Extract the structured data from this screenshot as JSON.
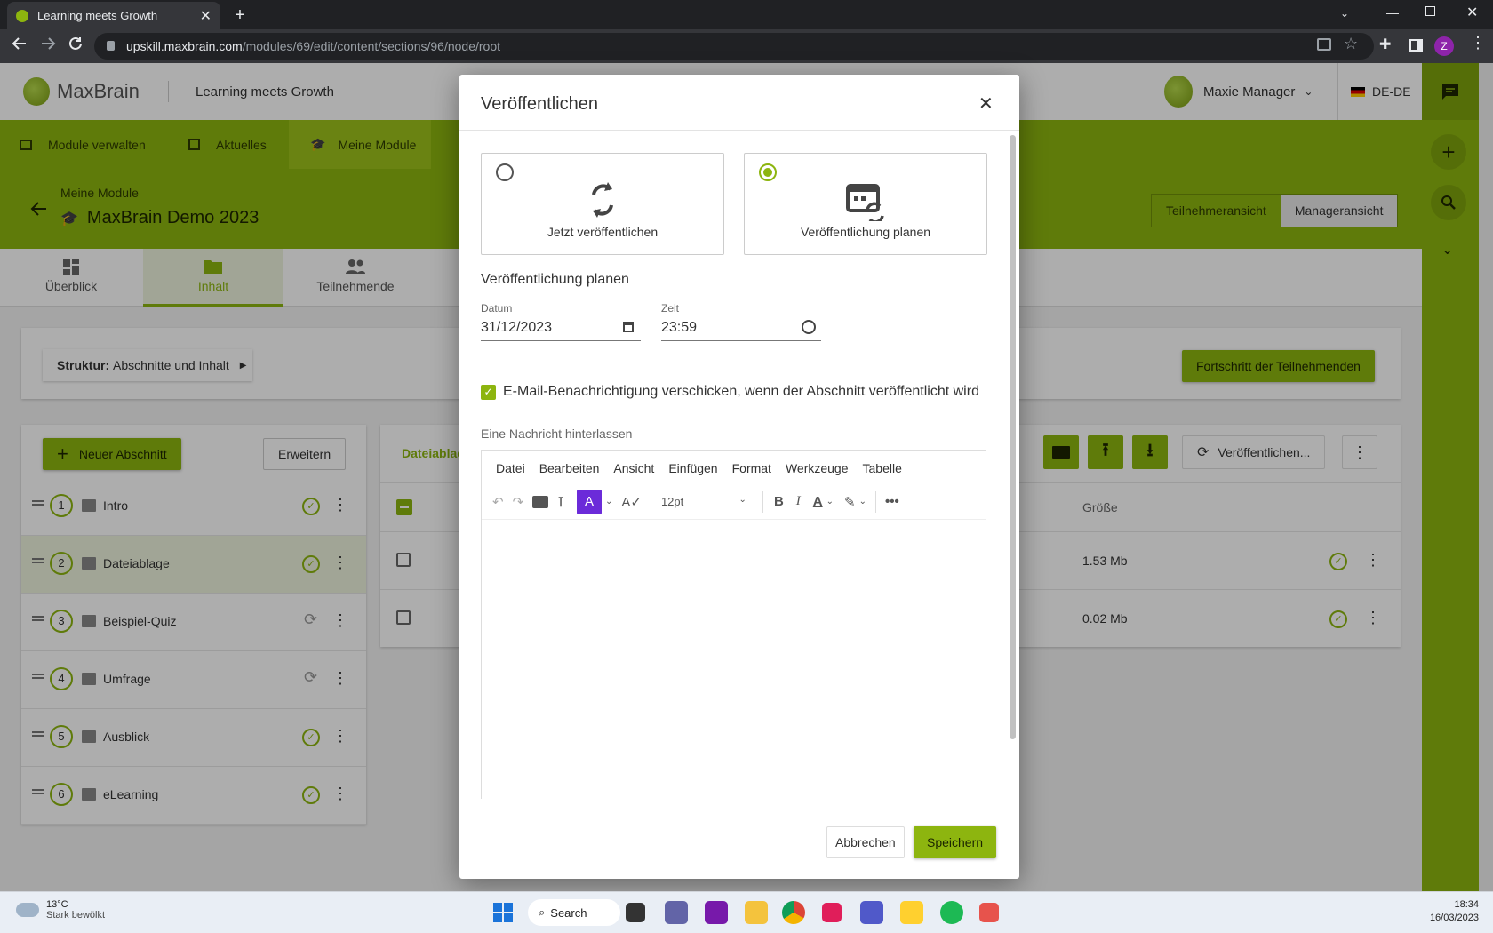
{
  "browser": {
    "tab_title": "Learning meets Growth",
    "url_host": "upskill.maxbrain.com",
    "url_path": "/modules/69/edit/content/sections/96/node/root",
    "profile_initial": "Z"
  },
  "header": {
    "brand": "MaxBrain",
    "tagline": "Learning meets Growth",
    "user_name": "Maxie Manager",
    "language": "DE-DE"
  },
  "topnav": {
    "items": [
      {
        "label": "Module verwalten"
      },
      {
        "label": "Aktuelles"
      },
      {
        "label": "Meine Module"
      }
    ]
  },
  "title": {
    "breadcrumb": "Meine Module",
    "module_name": "MaxBrain Demo 2023",
    "view_participant": "Teilnehmeransicht",
    "view_manager": "Manageransicht"
  },
  "page_tabs": [
    {
      "label": "Überblick"
    },
    {
      "label": "Inhalt"
    },
    {
      "label": "Teilnehmende"
    }
  ],
  "toolbar": {
    "structure_prefix": "Struktur:",
    "structure_value": "Abschnitte und Inhalt",
    "progress_button": "Fortschritt der Teilnehmenden",
    "new_section": "Neuer Abschnitt",
    "expand": "Erweitern",
    "publish_button": "Veröffentlichen...",
    "panel_title": "Dateiablag"
  },
  "sections": [
    {
      "num": "1",
      "label": "Intro",
      "status": "published"
    },
    {
      "num": "2",
      "label": "Dateiablage",
      "status": "published"
    },
    {
      "num": "3",
      "label": "Beispiel-Quiz",
      "status": "pending"
    },
    {
      "num": "4",
      "label": "Umfrage",
      "status": "pending"
    },
    {
      "num": "5",
      "label": "Ausblick",
      "status": "published"
    },
    {
      "num": "6",
      "label": "eLearning",
      "status": "published"
    }
  ],
  "files": {
    "size_header": "Größe",
    "rows": [
      {
        "size": "1.53 Mb"
      },
      {
        "size": "0.02 Mb"
      }
    ]
  },
  "modal": {
    "title": "Veröffentlichen",
    "option_now": "Jetzt veröffentlichen",
    "option_schedule": "Veröffentlichung planen",
    "selected_option": "schedule",
    "schedule_heading": "Veröffentlichung planen",
    "date_label": "Datum",
    "date_value": "31/12/2023",
    "time_label": "Zeit",
    "time_value": "23:59",
    "email_checkbox_label": "E-Mail-Benachrichtigung verschicken, wenn der Abschnitt veröffentlicht wird",
    "email_checked": true,
    "message_label": "Eine Nachricht hinterlassen",
    "editor_menu": [
      "Datei",
      "Bearbeiten",
      "Ansicht",
      "Einfügen",
      "Format",
      "Werkzeuge",
      "Tabelle"
    ],
    "font_size": "12pt",
    "cancel": "Abbrechen",
    "save": "Speichern"
  },
  "taskbar": {
    "temperature": "13°C",
    "weather": "Stark bewölkt",
    "search": "Search",
    "time": "18:34",
    "date": "16/03/2023"
  },
  "colors": {
    "accent": "#8db50f",
    "accent_dark": "#6f8f0a",
    "chrome_dark": "#202124",
    "chrome_mid": "#35363a"
  }
}
